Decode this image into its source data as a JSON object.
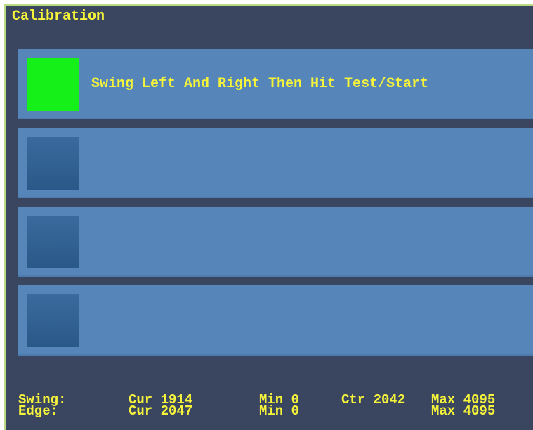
{
  "window": {
    "title": "Calibration"
  },
  "rows": [
    {
      "indicator_color": "#15f018",
      "indicator_state": "active",
      "label": "Swing Left And Right Then Hit Test/Start"
    },
    {
      "indicator_color": "#2f5f93",
      "indicator_state": "inactive",
      "label": ""
    },
    {
      "indicator_color": "#2f5f93",
      "indicator_state": "inactive",
      "label": ""
    },
    {
      "indicator_color": "#2f5f93",
      "indicator_state": "inactive",
      "label": ""
    }
  ],
  "stats": {
    "swing": {
      "label": "Swing:",
      "cur": "Cur 1914",
      "min": "Min 0",
      "ctr": "Ctr 2042",
      "max": "Max 4095"
    },
    "edge": {
      "label": "Edge:",
      "cur": "Cur 2047",
      "min": "Min 0",
      "max": "Max 4095"
    }
  },
  "colors": {
    "background": "#3a4660",
    "row": "#5585b9",
    "text": "#f5f33a",
    "active_indicator": "#15f018",
    "inactive_indicator": "#2f5f93"
  }
}
